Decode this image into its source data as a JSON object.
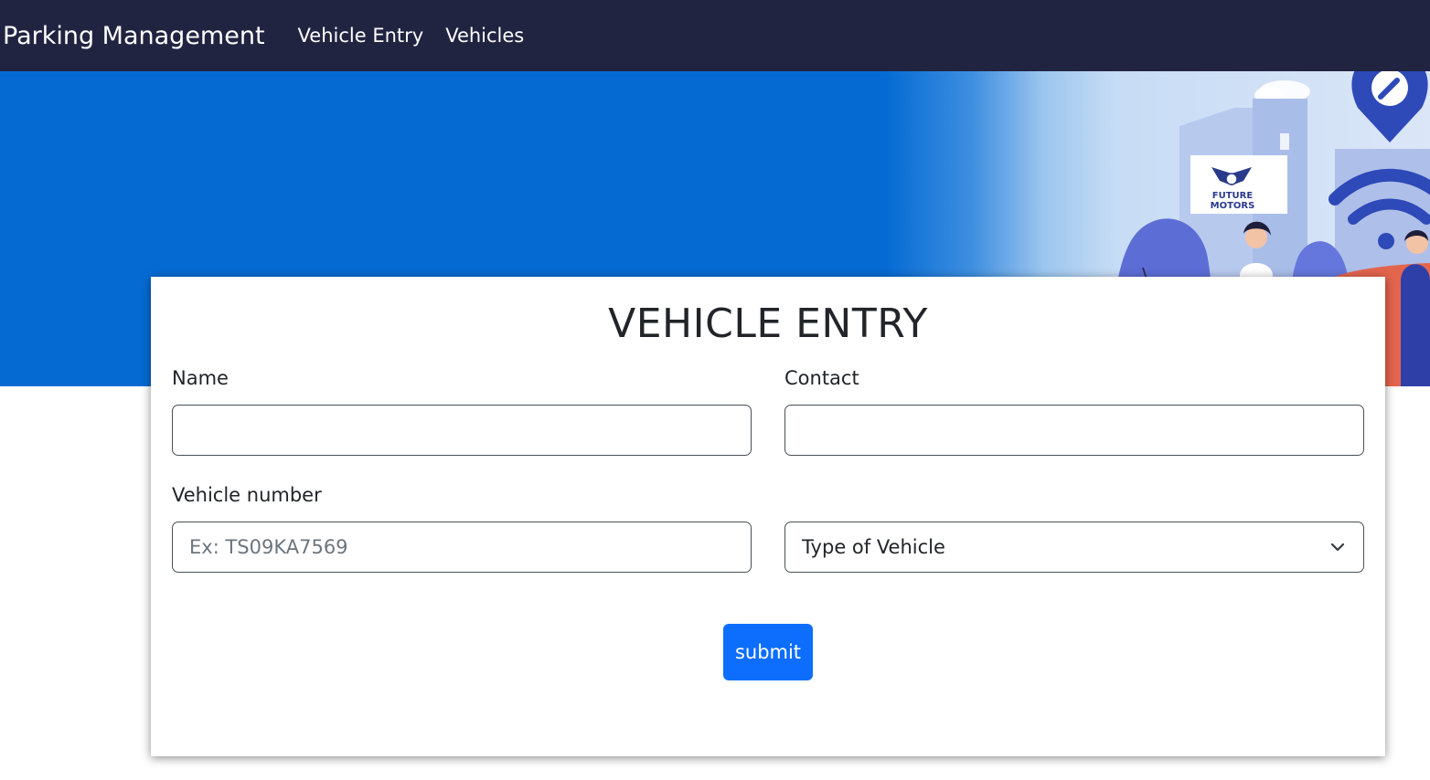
{
  "navbar": {
    "brand": "Parking Management",
    "links": [
      "Vehicle Entry",
      "Vehicles"
    ]
  },
  "hero": {
    "sign_line1": "FUTURE",
    "sign_line2": "MOTORS"
  },
  "form": {
    "title": "VEHICLE ENTRY",
    "name_label": "Name",
    "name_value": "",
    "contact_label": "Contact",
    "contact_value": "",
    "vehicle_number_label": "Vehicle number",
    "vehicle_number_placeholder": "Ex: TS09KA7569",
    "vehicle_type_selected": "Type of Vehicle",
    "submit_label": "submit"
  },
  "colors": {
    "navbar_bg": "#212441",
    "hero_blue": "#056bd3",
    "submit_blue": "#0d6efd"
  }
}
